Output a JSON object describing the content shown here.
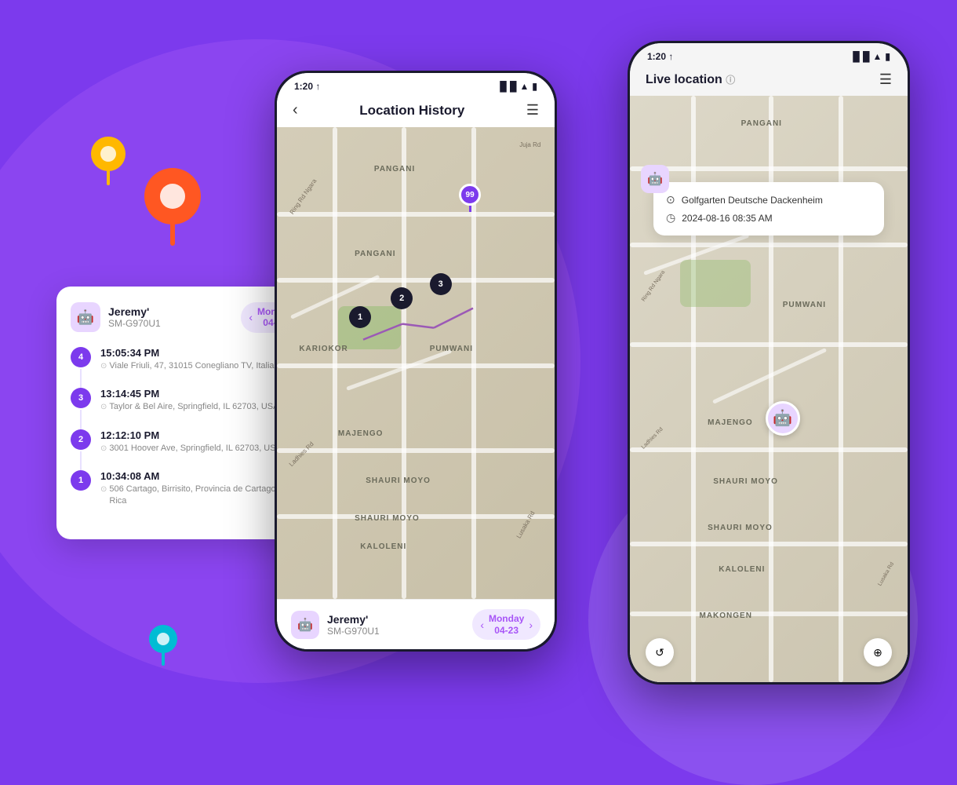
{
  "background": {
    "primary_color": "#7c3aed"
  },
  "decorative_pins": {
    "yellow": "📍",
    "orange": "📍",
    "teal": "📍"
  },
  "history_card": {
    "device_name": "Jeremy'",
    "device_model": "SM-G970U1",
    "date_label": "Monday\n04-23",
    "avatar_emoji": "🤖",
    "items": [
      {
        "step": "4",
        "time": "15:05:34 PM",
        "address": "Viale Friuli, 47, 31015 Conegliano TV, Italia"
      },
      {
        "step": "3",
        "time": "13:14:45 PM",
        "address": "Taylor & Bel Aire, Springfield, IL 62703, USA"
      },
      {
        "step": "2",
        "time": "12:12:10 PM",
        "address": "3001 Hoover Ave, Springfield, IL 62703, USA"
      },
      {
        "step": "1",
        "time": "10:34:08 AM",
        "address": "506 Cartago, Birrisito, Provincia de Cartago, Costa Rica"
      }
    ]
  },
  "phone_middle": {
    "status_bar": {
      "time": "1:20",
      "arrow": "↑",
      "signal": "WiFi + Bars + Battery"
    },
    "header": {
      "title": "Location History",
      "back_label": "‹",
      "menu_label": "☰"
    },
    "map_labels": [
      "PANGANI",
      "KARIOKOR",
      "PUMWANI",
      "MAJENGO",
      "SHAURI MOYO",
      "KALOLENI"
    ],
    "route_pins": [
      "1",
      "2",
      "3"
    ],
    "purple_pin_count": "99",
    "bottom_bar": {
      "device_name": "Jeremy'",
      "device_model": "SM-G970U1",
      "date_label": "Monday\n04-23",
      "avatar_emoji": "🤖"
    }
  },
  "phone_right": {
    "status_bar": {
      "time": "1:20",
      "arrow": "↑"
    },
    "header": {
      "title": "Live location",
      "info_icon": "ⓘ",
      "menu_icon": "☰"
    },
    "popup": {
      "location_name": "Golfgarten Deutsche  Dackenheim",
      "timestamp": "2024-08-16  08:35 AM"
    },
    "map_labels": [
      "PANGANI",
      "PUMWANI",
      "MAJENGO",
      "SHAURI MOYO",
      "KALOLENI",
      "MAKONGEN"
    ],
    "monster_avatar": "🤖"
  }
}
